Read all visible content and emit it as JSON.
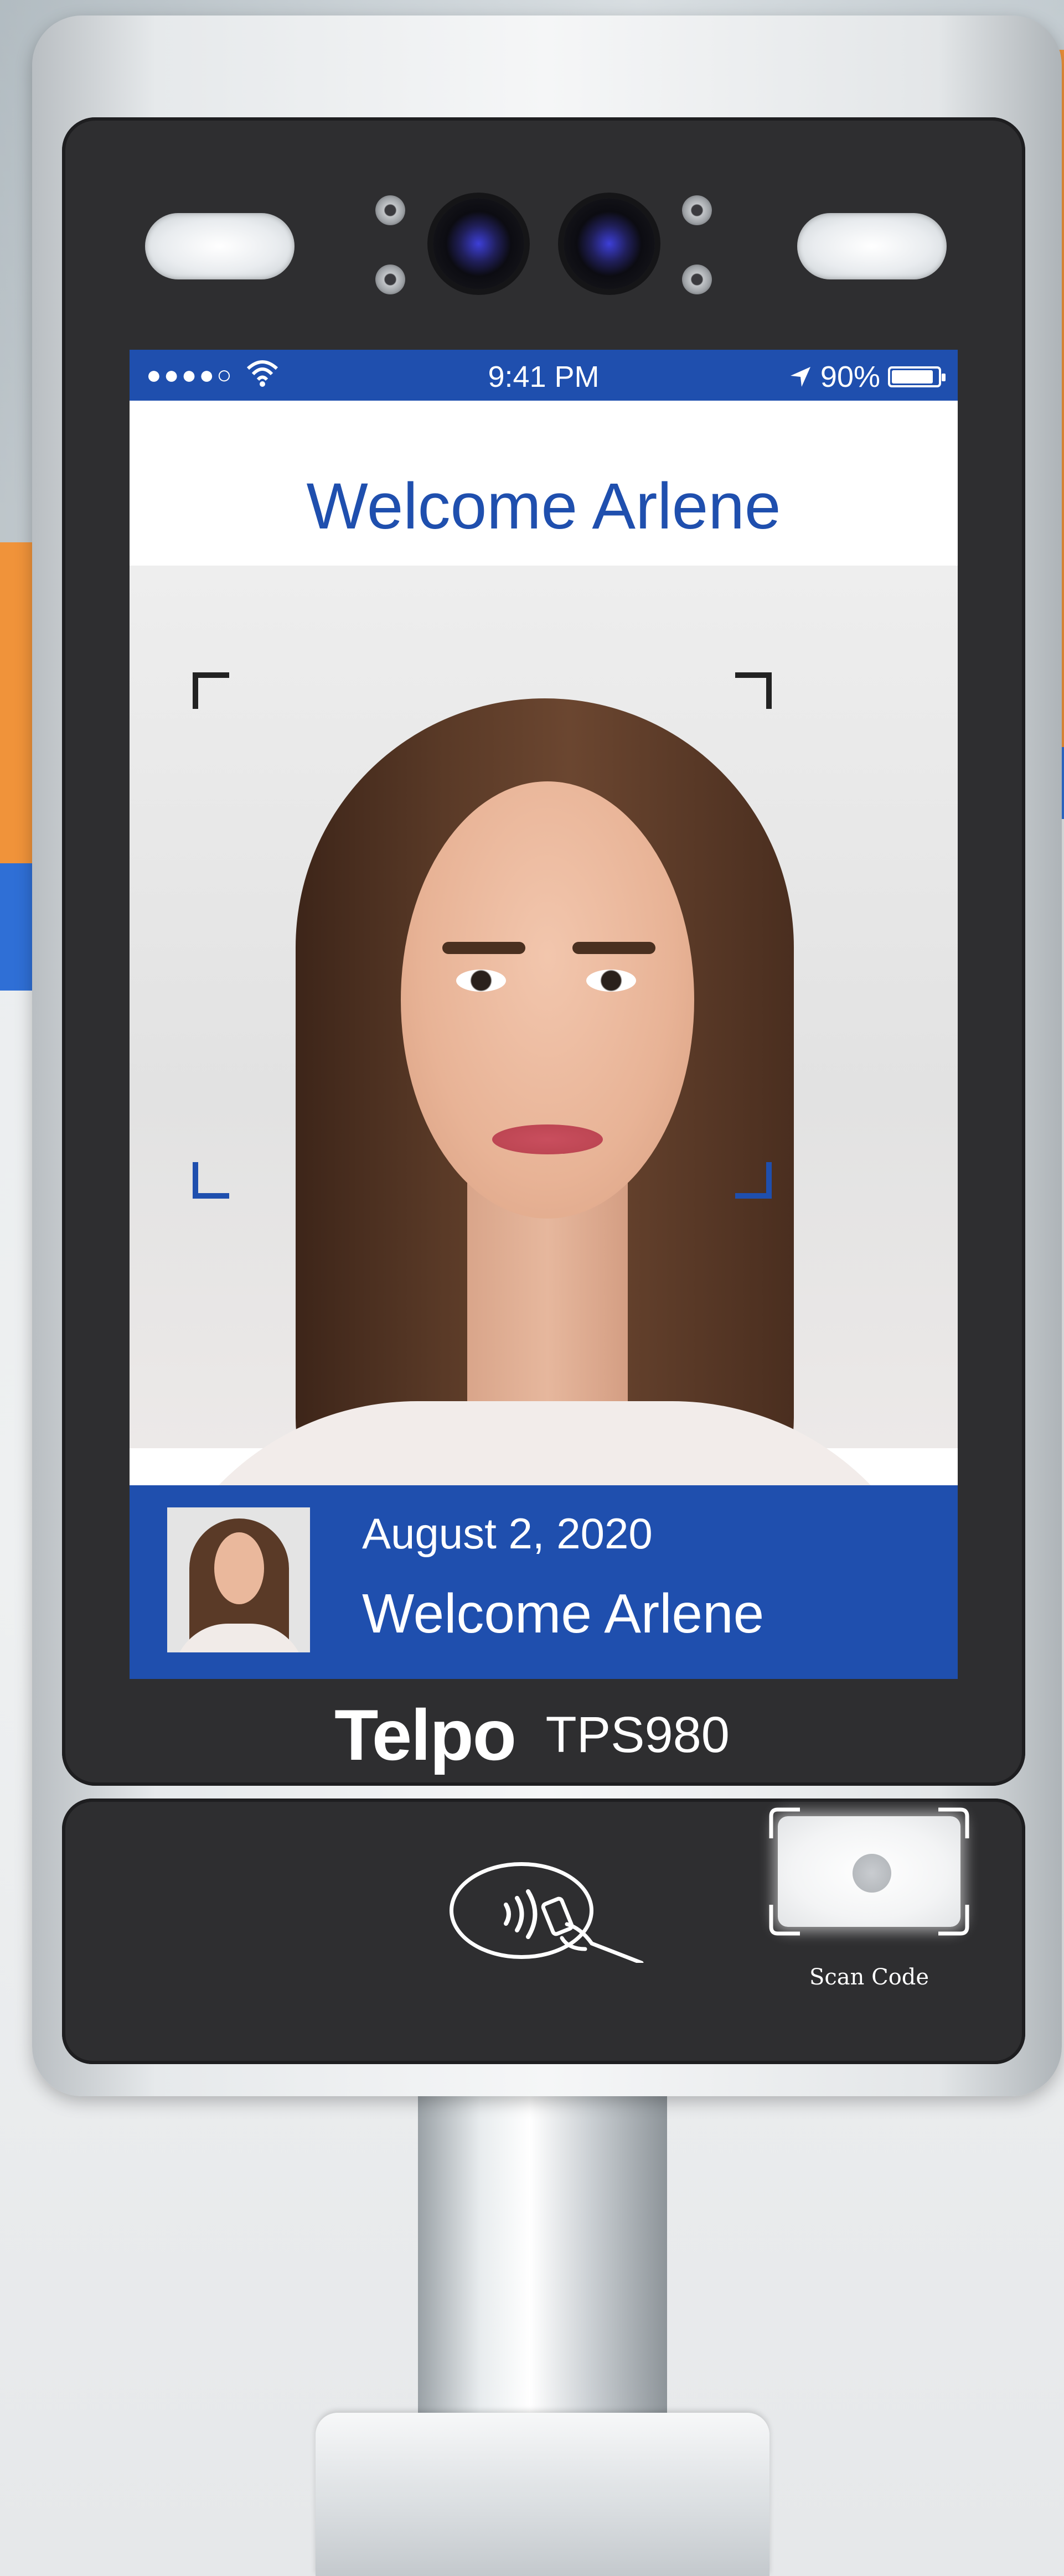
{
  "device": {
    "brand": "Telpo",
    "model": "TPS980"
  },
  "status_bar": {
    "signal": "●●●●○",
    "time": "9:41 PM",
    "battery": "90%",
    "battery_level": 0.9
  },
  "screen": {
    "welcome_title": "Welcome Arlene"
  },
  "info_bar": {
    "date": "August 2, 2020",
    "welcome": "Welcome Arlene"
  },
  "scanner": {
    "label": "Scan Code"
  },
  "colors": {
    "screen_accent": "#1f4fae",
    "bezel": "#2e2e30",
    "accent_orange": "#f0933a"
  },
  "icons": [
    "wifi-icon",
    "location-arrow-icon",
    "battery-icon",
    "nfc-contactless-icon",
    "camera-lens-icon",
    "ir-light-icon"
  ]
}
